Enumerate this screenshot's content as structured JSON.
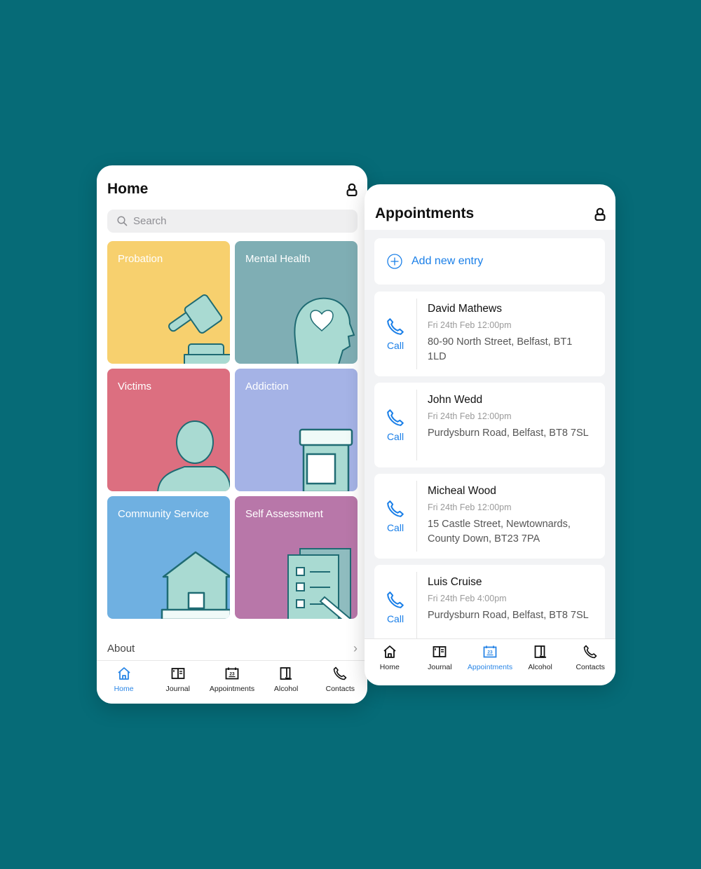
{
  "colors": {
    "background": "#066b77",
    "accent": "#1a7fe8",
    "tile_probation": "#f7d06e",
    "tile_mental_health": "#7faeb4",
    "tile_victims": "#dc6f80",
    "tile_addiction": "#a5b3e6",
    "tile_community_service": "#6fb0e1",
    "tile_self_assessment": "#b877a9"
  },
  "home": {
    "title": "Home",
    "header_icon": "lock-icon",
    "search": {
      "placeholder": "Search",
      "value": ""
    },
    "tiles": [
      {
        "label": "Probation",
        "icon": "gavel-icon"
      },
      {
        "label": "Mental Health",
        "icon": "head-heart-icon"
      },
      {
        "label": "Victims",
        "icon": "person-icon"
      },
      {
        "label": "Addiction",
        "icon": "pill-bottle-icon"
      },
      {
        "label": "Community Service",
        "icon": "house-icon"
      },
      {
        "label": "Self Assessment",
        "icon": "checklist-icon"
      }
    ],
    "about_label": "About",
    "tabbar": [
      {
        "label": "Home",
        "icon": "home-icon",
        "active": true
      },
      {
        "label": "Journal",
        "icon": "journal-icon",
        "active": false
      },
      {
        "label": "Appointments",
        "icon": "calendar-icon",
        "active": false
      },
      {
        "label": "Alcohol",
        "icon": "alcohol-icon",
        "active": false
      },
      {
        "label": "Contacts",
        "icon": "phone-icon",
        "active": false
      }
    ]
  },
  "appointments": {
    "title": "Appointments",
    "header_icon": "lock-icon",
    "add_label": "Add new entry",
    "call_label": "Call",
    "calendar_day": "23",
    "items": [
      {
        "name": "David Mathews",
        "time": "Fri 24th Feb 12:00pm",
        "address": "80-90 North Street, Belfast, BT1 1LD"
      },
      {
        "name": "John Wedd",
        "time": "Fri 24th Feb 12:00pm",
        "address": "Purdysburn Road, Belfast, BT8 7SL"
      },
      {
        "name": "Micheal Wood",
        "time": "Fri 24th Feb 12:00pm",
        "address": "15 Castle Street, Newtownards, County Down, BT23 7PA"
      },
      {
        "name": "Luis Cruise",
        "time": "Fri 24th Feb 4:00pm",
        "address": "Purdysburn Road, Belfast, BT8 7SL"
      }
    ],
    "tabbar": [
      {
        "label": "Home",
        "icon": "home-icon",
        "active": false
      },
      {
        "label": "Journal",
        "icon": "journal-icon",
        "active": false
      },
      {
        "label": "Appointments",
        "icon": "calendar-icon",
        "active": true
      },
      {
        "label": "Alcohol",
        "icon": "alcohol-icon",
        "active": false
      },
      {
        "label": "Contacts",
        "icon": "phone-icon",
        "active": false
      }
    ]
  }
}
